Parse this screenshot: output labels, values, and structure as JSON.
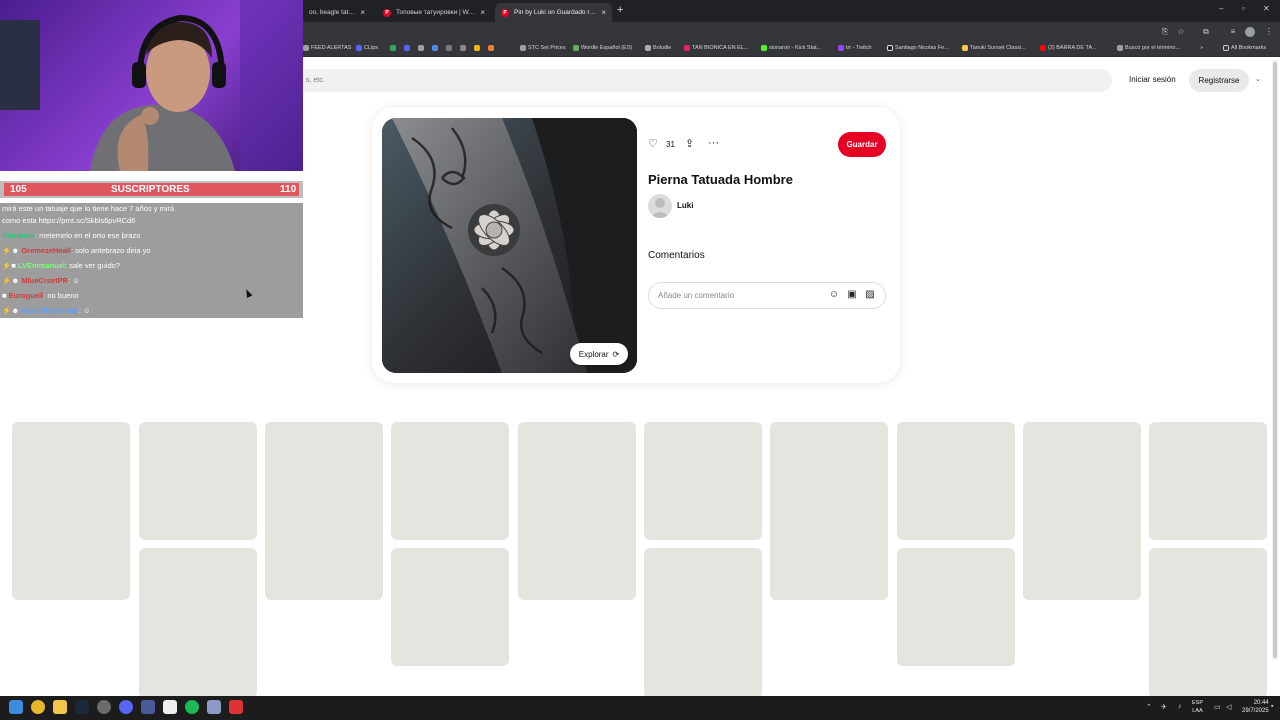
{
  "browser": {
    "tabs": [
      {
        "label": "oo, beagle tattoo id",
        "active": false
      },
      {
        "label": "Топовые татуировки | Wolf tat",
        "active": false
      },
      {
        "label": "Pin by Luki on Guardado rápido",
        "active": true
      }
    ],
    "new_tab": "+",
    "bookmarks": [
      "FEED ALERTAS",
      "CLips",
      "STC Set Prices",
      "Wordle Español (ES)",
      "Boludle",
      "TAN BIONICA EN EL...",
      "sionaron - Kick Stat...",
      "trr - Twitch",
      "Santiago Nicolas Fe...",
      "Tanuki Sunset Classi...",
      "(2) BARRA DE TA...",
      "Buscó por el término...",
      "All Bookmarks"
    ],
    "bookmarks_more": "»"
  },
  "pinterest": {
    "search_placeholder": "s, etc.",
    "login_label": "Iniciar sesión",
    "register_label": "Registrarse",
    "like_count": "31",
    "save_label": "Guardar",
    "pin_title": "Pierna Tatuada Hombre",
    "author": "Luki",
    "comments_heading": "Comentarios",
    "comment_placeholder": "Añade un comentario",
    "explore_label": "Explorar"
  },
  "stream": {
    "sub_goal": {
      "current": "105",
      "label": "SUSCRIPTORES",
      "target": "110"
    },
    "chat": [
      {
        "user": "",
        "text": "mirá este un tatuaje que lo tiene hace 7 años y mirá"
      },
      {
        "user": "",
        "text": "como esta https://prnt.sc/Skbls6pvRCd6"
      },
      {
        "user": "XfardoxX",
        "text": ": metemelo en el orto ese brazo"
      },
      {
        "user": "GremezeHeall",
        "text": ": solo antebrazo diria yo"
      },
      {
        "user": "LVEmmanuel",
        "text": ": sale ver guido?"
      },
      {
        "user": "MlueCrsetPR",
        "text": ":"
      },
      {
        "user": "Euroguell",
        "text": ": no bueno"
      },
      {
        "user": "NazaTheCreator",
        "text": ":"
      }
    ]
  },
  "taskbar": {
    "lang": "ESP",
    "lang2": "LAA",
    "time": "20:44",
    "date": "29/7/2025"
  },
  "colors": {
    "pinterest_red": "#e60023",
    "sub_bar": "#e0565f",
    "chrome_dark": "#35363a"
  }
}
